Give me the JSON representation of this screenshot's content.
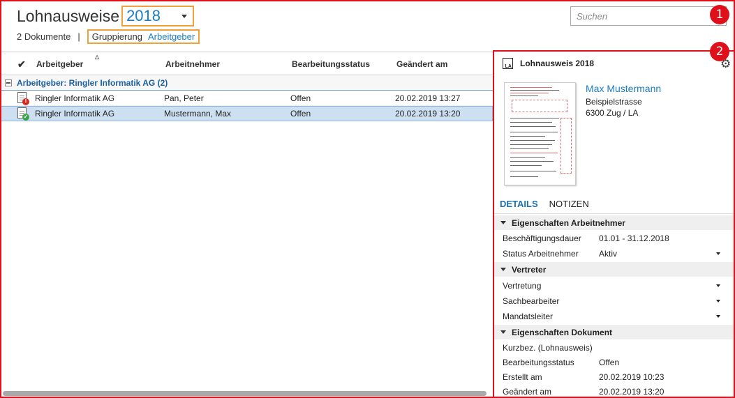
{
  "header": {
    "title": "Lohnausweise",
    "year": "2018",
    "doc_count": "2 Dokumente",
    "separator": "|",
    "grouping_label": "Gruppierung",
    "grouping_value": "Arbeitgeber"
  },
  "search": {
    "placeholder": "Suchen"
  },
  "markers": [
    "1",
    "2"
  ],
  "grid": {
    "columns": [
      "Arbeitgeber",
      "Arbeitnehmer",
      "Bearbeitungsstatus",
      "Geändert am"
    ],
    "group_label": "Arbeitgeber: Ringler Informatik AG (2)",
    "rows": [
      {
        "employer": "Ringler Informatik AG",
        "employee": "Pan, Peter",
        "status": "Offen",
        "changed": "20.02.2019 13:27",
        "icon": "doc-error-icon"
      },
      {
        "employer": "Ringler Informatik AG",
        "employee": "Mustermann, Max",
        "status": "Offen",
        "changed": "20.02.2019 13:20",
        "icon": "doc-ok-icon"
      }
    ]
  },
  "detail": {
    "title": "Lohnausweis 2018",
    "doc_icon_text": "LA",
    "person": {
      "name": "Max Mustermann",
      "street": "Beispielstrasse",
      "city": "6300 Zug / LA"
    },
    "tabs": [
      "DETAILS",
      "NOTIZEN"
    ],
    "sections": [
      {
        "title": "Eigenschaften Arbeitnehmer",
        "props": [
          {
            "key": "Beschäftigungsdauer",
            "value": "01.01 - 31.12.2018"
          },
          {
            "key": "Status Arbeitnehmer",
            "value": "Aktiv"
          }
        ]
      },
      {
        "title": "Vertreter",
        "props": [
          {
            "key": "Vertretung",
            "value": ""
          },
          {
            "key": "Sachbearbeiter",
            "value": ""
          },
          {
            "key": "Mandatsleiter",
            "value": ""
          }
        ]
      },
      {
        "title": "Eigenschaften Dokument",
        "props": [
          {
            "key": "Kurzbez. (Lohnausweis)",
            "value": ""
          },
          {
            "key": "Bearbeitungsstatus",
            "value": "Offen"
          },
          {
            "key": "Erstellt am",
            "value": "20.02.2019 10:23"
          },
          {
            "key": "Geändert am",
            "value": "20.02.2019 13:20"
          }
        ]
      }
    ]
  },
  "colors": {
    "accent": "#1a7cc4",
    "highlight_box": "#f0a238",
    "annotation": "#e0101a",
    "selected_row": "#cde0f1"
  }
}
